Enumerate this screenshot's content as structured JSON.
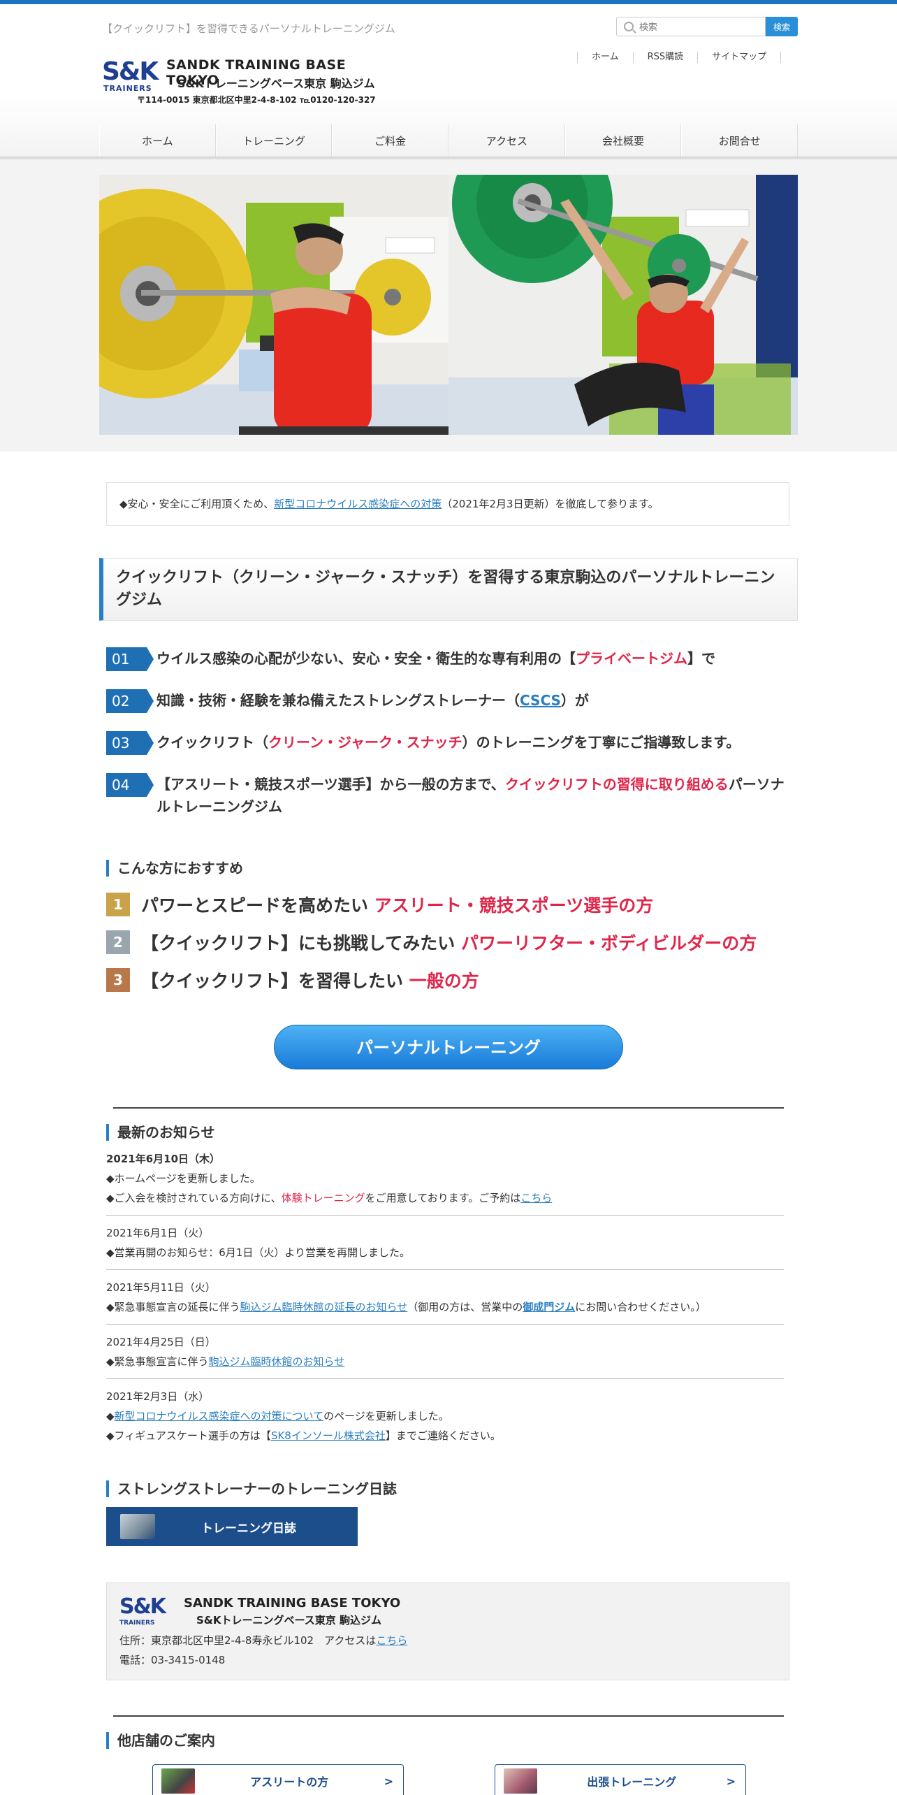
{
  "header": {
    "tagline": "【クイックリフト】を習得できるパーソナルトレーニングジム",
    "search_placeholder": "検索",
    "search_button": "検索",
    "toplinks": [
      "ホーム",
      "RSS購読",
      "サイトマップ"
    ],
    "logo": {
      "mark": "S&K",
      "mark_sub": "TRAINERS",
      "name_en": "SANDK TRAINING BASE TOKYO",
      "name_jp": "S&Kトレーニングベース東京 駒込ジム",
      "address": "〒114-0015 東京都北区中里2-4-8-102  ℡0120-120-327"
    },
    "nav": [
      "ホーム",
      "トレーニング",
      "ご料金",
      "アクセス",
      "会社概要",
      "お問合せ"
    ]
  },
  "notice": {
    "prefix": "◆安心・安全にご利用頂くため、",
    "link": "新型コロナウイルス感染症への対策",
    "suffix": "（2021年2月3日更新）を徹底して参ります。"
  },
  "main_heading": "クイックリフト（クリーン・ジャーク・スナッチ）を習得する東京駒込のパーソナルトレーニングジム",
  "points": [
    {
      "num": "01",
      "a": "ウイルス感染の心配が少ない、安心・安全・衛生的な専有利用の【",
      "b": "プライベートジム",
      "c": "】で",
      "style": "red"
    },
    {
      "num": "02",
      "a": "知識・技術・経験を兼ね備えたストレングストレーナー（",
      "b": "CSCS",
      "c": "）が",
      "style": "link"
    },
    {
      "num": "03",
      "a": "クイックリフト（",
      "b": "クリーン・ジャーク・スナッチ",
      "c": "）のトレーニングを丁寧にご指導致します。",
      "style": "red"
    },
    {
      "num": "04",
      "a": "【アスリート・競技スポーツ選手】から一般の方まで、",
      "b": "クイックリフトの習得に取り組める",
      "c": "パーソナルトレーニングジム",
      "style": "red"
    }
  ],
  "recommend": {
    "title": "こんな方におすすめ",
    "items": [
      {
        "rank": "1",
        "color": "#c9a24a",
        "a": "パワーとスピードを高めたい ",
        "b": "アスリート・競技スポーツ選手の方"
      },
      {
        "rank": "2",
        "color": "#9aa6ad",
        "a": "【クイックリフト】にも挑戦してみたい ",
        "b": "パワーリフター・ボディビルダーの方"
      },
      {
        "rank": "3",
        "color": "#b8784a",
        "a": "【クイックリフト】を習得したい ",
        "b": "一般の方"
      }
    ]
  },
  "cta": "パーソナルトレーニング",
  "news": {
    "title": "最新のお知らせ",
    "e1": {
      "date": "2021年6月10日（木）",
      "l1": "◆ホームページを更新しました。",
      "l2a": "◆ご入会を検討されている方向けに、",
      "l2b": "体験トレーニング",
      "l2c": "をご用意しております。ご予約は",
      "l2d": "こちら"
    },
    "e2": {
      "date": "2021年6月1日（火）",
      "l1": "◆営業再開のお知らせ：6月1日（火）より営業を再開しました。"
    },
    "e3": {
      "date": "2021年5月11日（火）",
      "a": "◆緊急事態宣言の延長に伴う",
      "b": "駒込ジム臨時休館の延長のお知らせ",
      "c": "（御用の方は、営業中の",
      "d": "御成門ジム",
      "e": "にお問い合わせください。）"
    },
    "e4": {
      "date": "2021年4月25日（日）",
      "a": "◆緊急事態宣言に伴う",
      "b": "駒込ジム臨時休館のお知らせ"
    },
    "e5": {
      "date": "2021年2月3日（水）",
      "a": "◆",
      "b": "新型コロナウイルス感染症への対策について",
      "c": "のページを更新しました。",
      "d": "◆フィギュアスケート選手の方は【",
      "e": "SK8インソール株式会社",
      "f": "】までご連絡ください。"
    }
  },
  "diary": {
    "title": "ストレングストレーナーのトレーニング日誌",
    "button": "トレーニング日誌"
  },
  "footer": {
    "mark": "S&K",
    "mark_sub": "TRAINERS",
    "name_en": "SANDK TRAINING BASE TOKYO",
    "name_jp": "S&Kトレーニングベース東京 駒込ジム",
    "address_prefix": "住所：東京都北区中里2-4-8寿永ビル102　アクセスは",
    "address_link": "こちら",
    "phone": "電話：03-3415-0148"
  },
  "stores": {
    "title": "他店舗のご案内",
    "items": [
      {
        "label": "アスリートの方",
        "arrow": ">"
      },
      {
        "label": "出張トレーニング",
        "arrow": ">"
      }
    ]
  },
  "colors": {
    "accent": "#1e73be",
    "highlight": "#e0254a",
    "navy": "#1d4e8c"
  }
}
